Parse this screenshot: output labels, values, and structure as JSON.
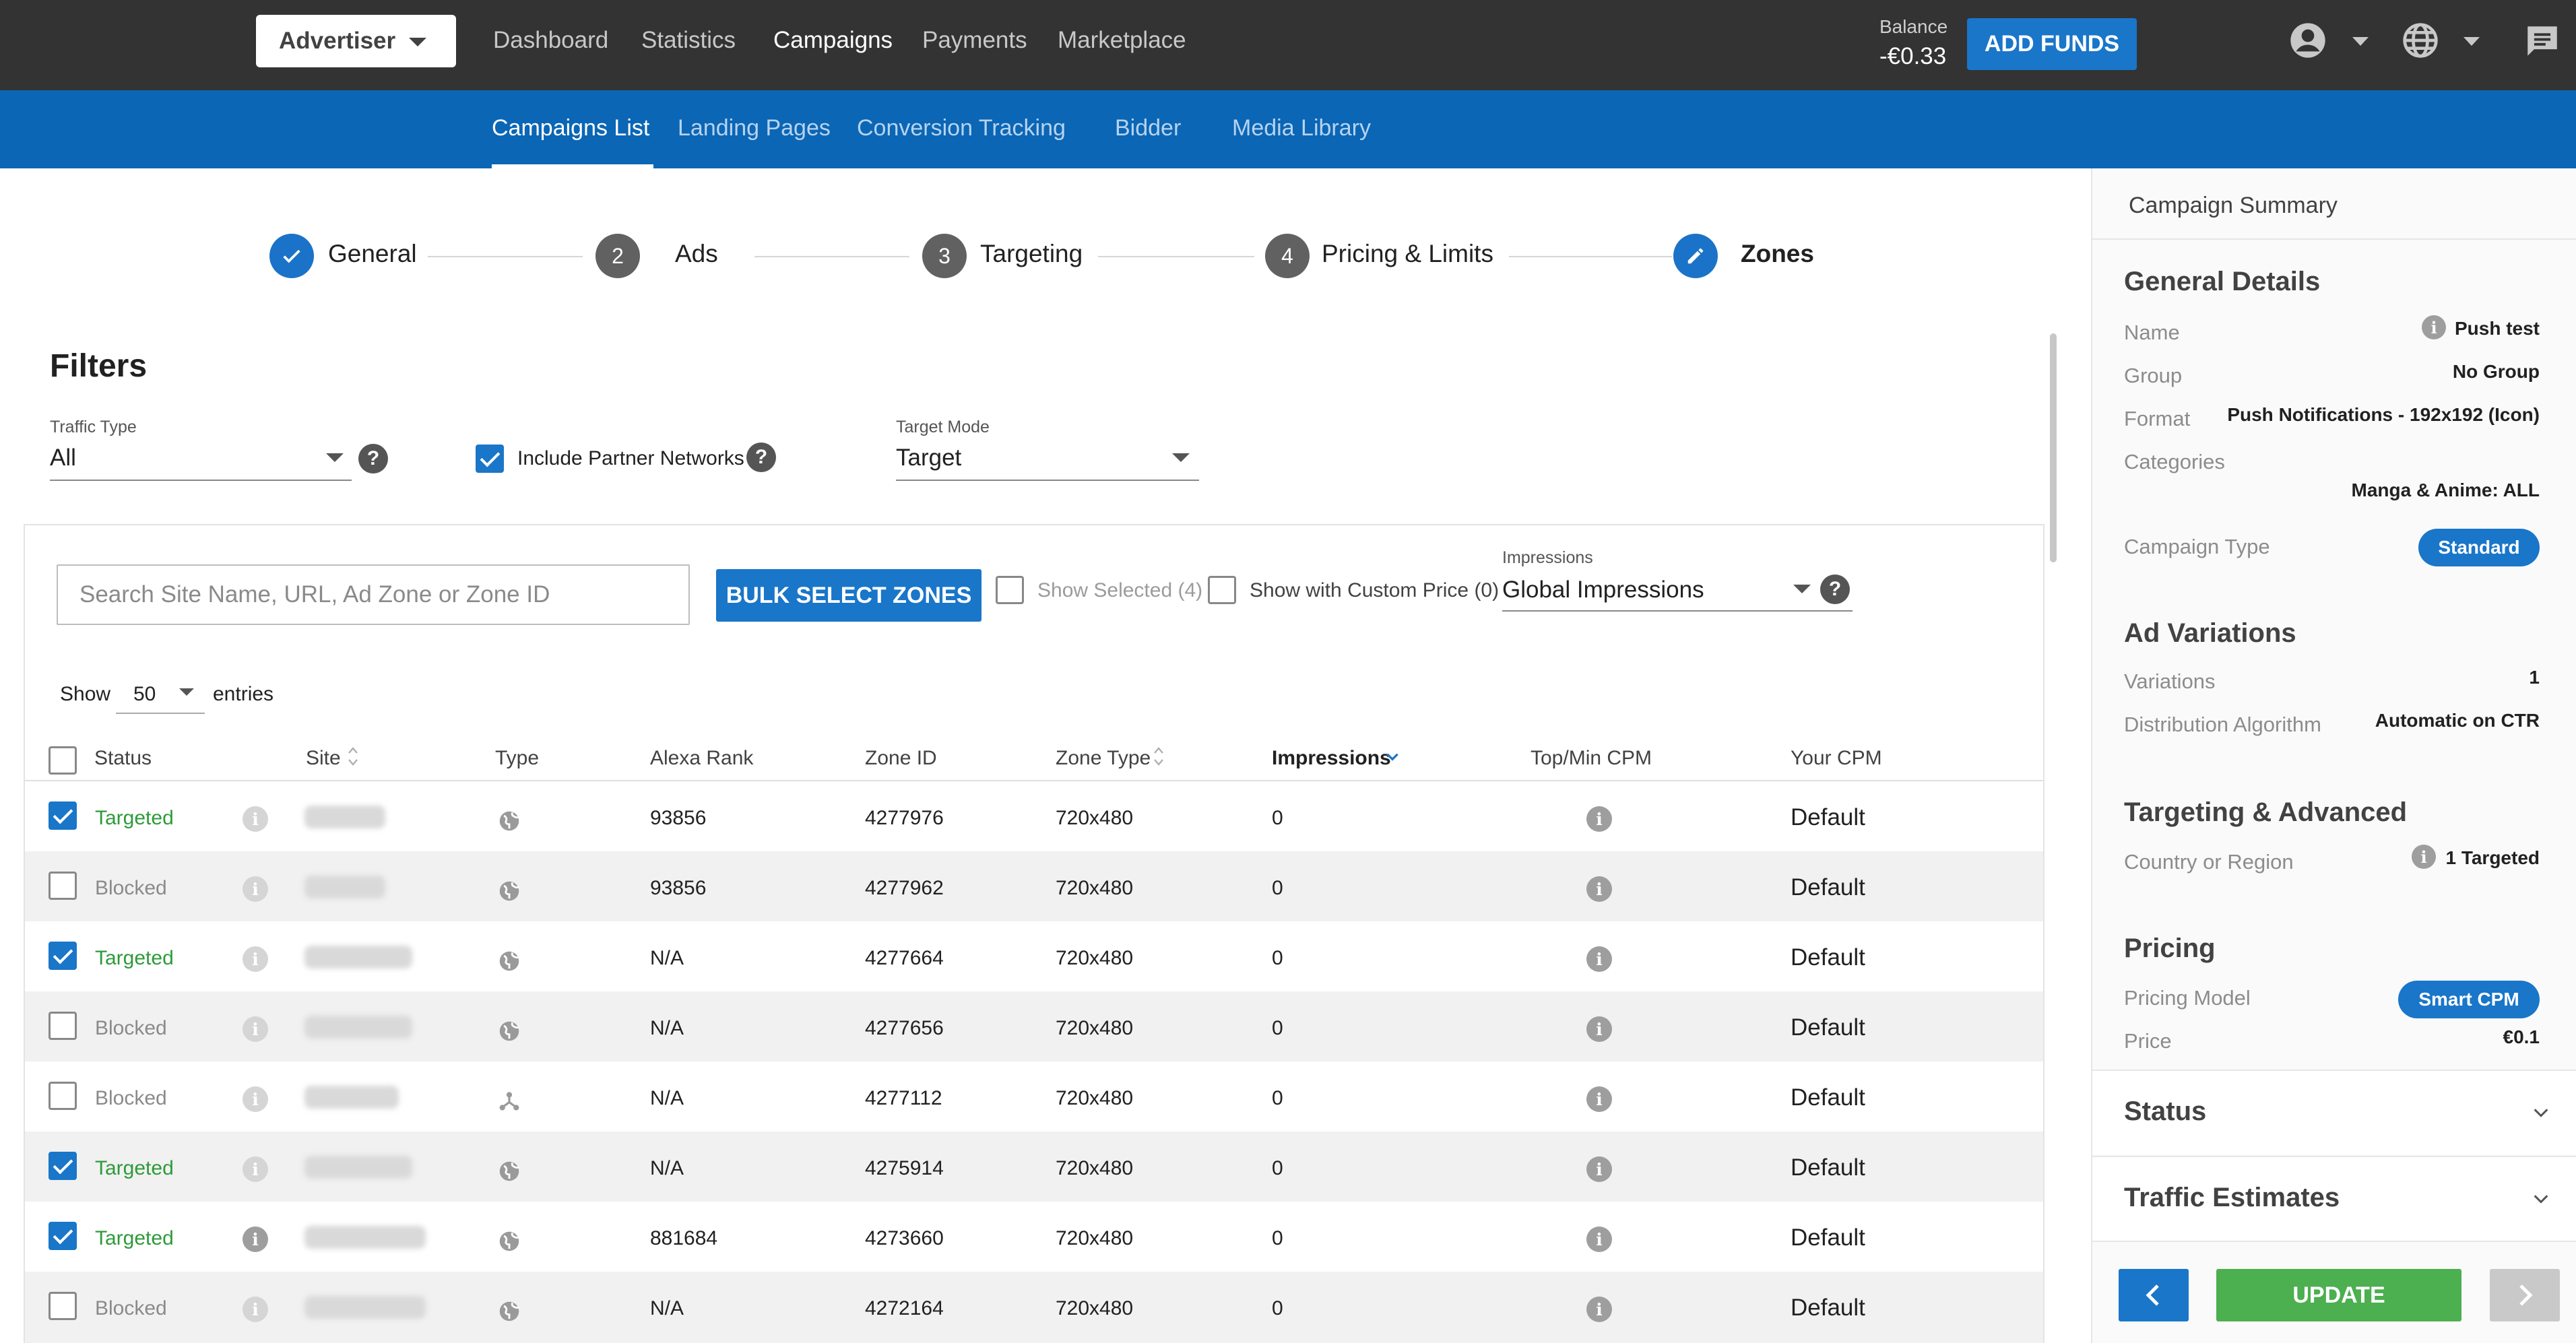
{
  "topbar": {
    "account_selector": "Advertiser",
    "nav": [
      "Dashboard",
      "Statistics",
      "Campaigns",
      "Payments",
      "Marketplace"
    ],
    "active_nav": "Campaigns",
    "balance_label": "Balance",
    "balance_value": "-€0.33",
    "add_funds_label": "ADD FUNDS",
    "icons": [
      "account-circle-icon",
      "globe-icon",
      "chat-icon"
    ]
  },
  "subnav": {
    "items": [
      "Campaigns List",
      "Landing Pages",
      "Conversion Tracking",
      "Bidder",
      "Media Library"
    ],
    "active": "Campaigns List"
  },
  "stepper": {
    "steps": [
      {
        "label": "General",
        "marker": "check-icon",
        "state": "done"
      },
      {
        "label": "Ads",
        "marker": "2",
        "state": "pending"
      },
      {
        "label": "Targeting",
        "marker": "3",
        "state": "pending"
      },
      {
        "label": "Pricing & Limits",
        "marker": "4",
        "state": "pending"
      },
      {
        "label": "Zones",
        "marker": "pencil-icon",
        "state": "active"
      }
    ]
  },
  "filters": {
    "title": "Filters",
    "traffic_type_label": "Traffic Type",
    "traffic_type_value": "All",
    "include_partner_label": "Include Partner Networks",
    "include_partner_checked": true,
    "target_mode_label": "Target Mode",
    "target_mode_value": "Target"
  },
  "toolbar": {
    "search_placeholder": "Search Site Name, URL, Ad Zone or Zone ID",
    "bulk_select_label": "BULK SELECT ZONES",
    "show_selected_label": "Show Selected (4)",
    "show_custom_price_label": "Show with Custom Price (0)",
    "impressions_label": "Impressions",
    "impressions_value": "Global Impressions"
  },
  "length_menu": {
    "show_label": "Show",
    "value": "50",
    "entries_label": "entries"
  },
  "table": {
    "columns": [
      "Status",
      "Site",
      "Type",
      "Alexa Rank",
      "Zone ID",
      "Zone Type",
      "Impressions",
      "Top/Min CPM",
      "Your CPM"
    ],
    "sorted_column": "Impressions",
    "rows": [
      {
        "checked": true,
        "status": "Targeted",
        "type": "globe-icon",
        "alexa_rank": "93856",
        "zone_id": "4277976",
        "zone_type": "720x480",
        "impressions": "0",
        "your_cpm": "Default"
      },
      {
        "checked": false,
        "status": "Blocked",
        "type": "globe-icon",
        "alexa_rank": "93856",
        "zone_id": "4277962",
        "zone_type": "720x480",
        "impressions": "0",
        "your_cpm": "Default"
      },
      {
        "checked": true,
        "status": "Targeted",
        "type": "globe-icon",
        "alexa_rank": "N/A",
        "zone_id": "4277664",
        "zone_type": "720x480",
        "impressions": "0",
        "your_cpm": "Default"
      },
      {
        "checked": false,
        "status": "Blocked",
        "type": "globe-icon",
        "alexa_rank": "N/A",
        "zone_id": "4277656",
        "zone_type": "720x480",
        "impressions": "0",
        "your_cpm": "Default"
      },
      {
        "checked": false,
        "status": "Blocked",
        "type": "network-icon",
        "alexa_rank": "N/A",
        "zone_id": "4277112",
        "zone_type": "720x480",
        "impressions": "0",
        "your_cpm": "Default"
      },
      {
        "checked": true,
        "status": "Targeted",
        "type": "globe-icon",
        "alexa_rank": "N/A",
        "zone_id": "4275914",
        "zone_type": "720x480",
        "impressions": "0",
        "your_cpm": "Default"
      },
      {
        "checked": true,
        "status": "Targeted",
        "type": "globe-icon",
        "alexa_rank": "881684",
        "zone_id": "4273660",
        "zone_type": "720x480",
        "impressions": "0",
        "your_cpm": "Default"
      },
      {
        "checked": false,
        "status": "Blocked",
        "type": "globe-icon",
        "alexa_rank": "N/A",
        "zone_id": "4272164",
        "zone_type": "720x480",
        "impressions": "0",
        "your_cpm": "Default"
      }
    ]
  },
  "summary": {
    "header": "Campaign Summary",
    "general_title": "General Details",
    "name_label": "Name",
    "name_value": "Push test",
    "group_label": "Group",
    "group_value": "No Group",
    "format_label": "Format",
    "format_value": "Push Notifications - 192x192 (Icon)",
    "categories_label": "Categories",
    "categories_value": "Manga & Anime: ALL",
    "campaign_type_label": "Campaign Type",
    "campaign_type_value": "Standard",
    "ad_variations_title": "Ad Variations",
    "variations_label": "Variations",
    "variations_value": "1",
    "distribution_label": "Distribution Algorithm",
    "distribution_value": "Automatic on CTR",
    "targeting_title": "Targeting & Advanced",
    "country_label": "Country or Region",
    "country_value": "1 Targeted",
    "pricing_title": "Pricing",
    "pricing_model_label": "Pricing Model",
    "pricing_model_value": "Smart CPM",
    "price_label": "Price",
    "price_value": "€0.1",
    "status_title": "Status",
    "traffic_title": "Traffic Estimates",
    "update_label": "UPDATE"
  },
  "colors": {
    "topbar": "#333333",
    "subnav": "#0b66b5",
    "accent": "#1976c9",
    "targeted": "#2e9a3a",
    "update": "#4caf50"
  }
}
